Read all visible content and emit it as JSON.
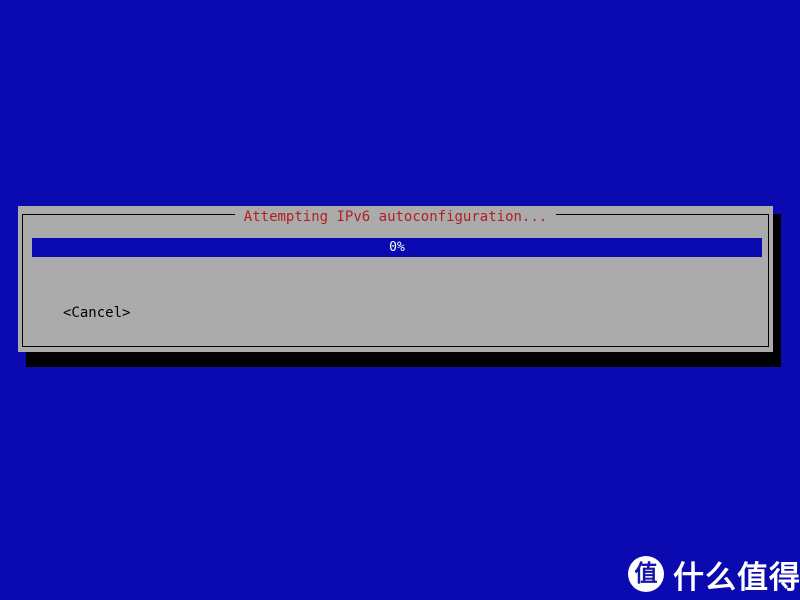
{
  "screen": {
    "background_color": "#0A0AB0",
    "description": "Debian installer text-mode network configuration screen"
  },
  "dialog": {
    "title": "Attempting IPv6 autoconfiguration...",
    "title_color": "#B02020",
    "background_color": "#ABABAB",
    "border_color": "#000000",
    "shadow_color": "#000000",
    "progress": {
      "percent": 0,
      "label": "0%",
      "bar_color": "#0A0AB0",
      "label_color": "#FFFFFF"
    },
    "buttons": [
      {
        "name": "cancel",
        "label": "<Cancel>",
        "focused": false
      }
    ]
  },
  "watermark": {
    "logo_glyph": "值",
    "text": "什么值得买",
    "color": "#FFFFFF"
  }
}
